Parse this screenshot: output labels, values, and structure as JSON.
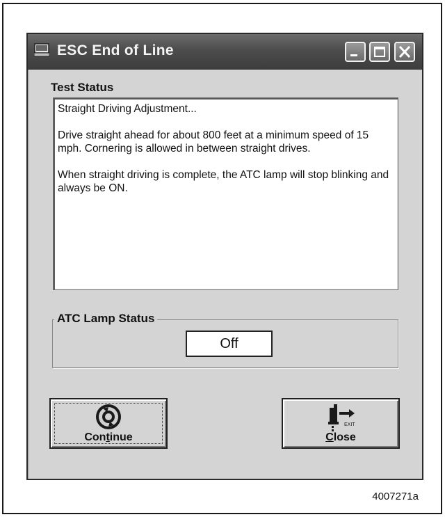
{
  "window": {
    "title": "ESC End of Line",
    "controls": {
      "minimize": "minimize",
      "maximize": "maximize",
      "close": "close"
    }
  },
  "test_status": {
    "heading": "Test Status",
    "lines": [
      "Straight Driving Adjustment...",
      "Drive straight ahead for about 800 feet at a minimum speed of 15 mph.  Cornering is allowed in between straight drives.",
      "When straight driving is complete, the ATC lamp will stop blinking and always be ON."
    ]
  },
  "atc_lamp": {
    "heading": "ATC Lamp Status",
    "value": "Off"
  },
  "buttons": {
    "continue": {
      "label_prefix": "Con",
      "label_mnemonic": "t",
      "label_suffix": "inue",
      "icon": "refresh-icon"
    },
    "close": {
      "label_mnemonic": "C",
      "label_suffix": "lose",
      "icon": "exit-icon",
      "icon_text": "EXIT"
    }
  },
  "figure_id": "4007271a"
}
